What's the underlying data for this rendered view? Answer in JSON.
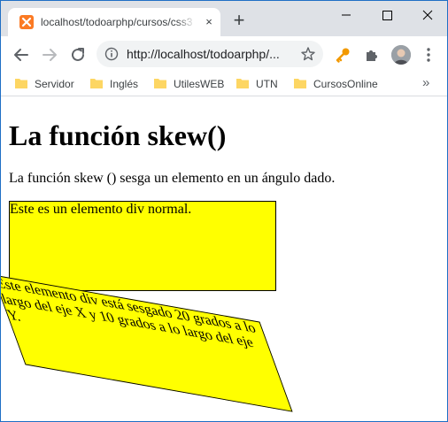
{
  "browser": {
    "tab": {
      "title": "localhost/todoarphp/cursos/css3",
      "close_label": "×"
    },
    "new_tab_label": "+",
    "url": "http://localhost/todoarphp/...",
    "accent_color": "#fb7a24",
    "icons": {
      "favicon": "xampp-icon",
      "back": "back-arrow-icon",
      "forward": "forward-arrow-icon",
      "reload": "reload-icon",
      "info": "info-icon",
      "star": "star-icon",
      "key": "key-icon",
      "extensions": "puzzle-icon",
      "menu": "three-dots-icon"
    }
  },
  "bookmarks": [
    {
      "label": "Servidor"
    },
    {
      "label": "Inglés"
    },
    {
      "label": "UtilesWEB"
    },
    {
      "label": "UTN"
    },
    {
      "label": "CursosOnline"
    }
  ],
  "bookmarks_more": "»",
  "page": {
    "heading": "La función skew()",
    "intro": "La función skew () sesga un elemento en un ángulo dado.",
    "normal_div_text": "Este es un elemento div normal.",
    "skewed_div_text": "Este elemento div está sesgado 20 grados a lo largo del eje X y 10 grados a lo largo del eje Y.",
    "box_color": "#ffff00"
  }
}
